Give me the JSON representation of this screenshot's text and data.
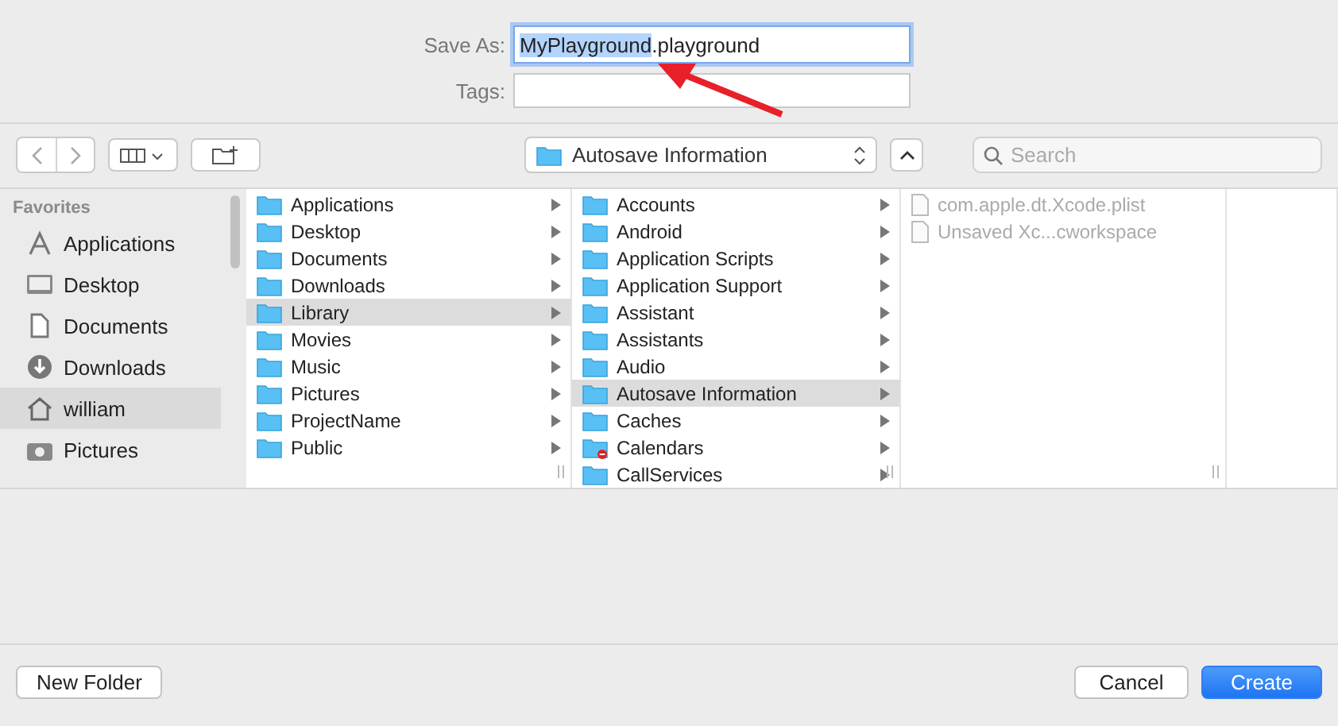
{
  "save_as": {
    "label": "Save As:",
    "selected_text": "MyPlayground",
    "text": ".playground"
  },
  "tags": {
    "label": "Tags:"
  },
  "toolbar": {
    "location": "Autosave Information",
    "search": {
      "placeholder": "Search"
    }
  },
  "sidebar": {
    "heading": "Favorites",
    "items": [
      {
        "label": "Applications",
        "selected": false
      },
      {
        "label": "Desktop",
        "selected": false
      },
      {
        "label": "Documents",
        "selected": false
      },
      {
        "label": "Downloads",
        "selected": false
      },
      {
        "label": "william",
        "selected": true
      },
      {
        "label": "Pictures",
        "selected": false
      }
    ]
  },
  "columns": [
    {
      "items": [
        {
          "label": "Applications",
          "selected": false,
          "kind": "folder",
          "locked": false
        },
        {
          "label": "Desktop",
          "selected": false,
          "kind": "folder",
          "locked": false
        },
        {
          "label": "Documents",
          "selected": false,
          "kind": "folder",
          "locked": false
        },
        {
          "label": "Downloads",
          "selected": false,
          "kind": "folder",
          "locked": false
        },
        {
          "label": "Library",
          "selected": true,
          "kind": "folder",
          "locked": false
        },
        {
          "label": "Movies",
          "selected": false,
          "kind": "folder",
          "locked": false
        },
        {
          "label": "Music",
          "selected": false,
          "kind": "folder",
          "locked": false
        },
        {
          "label": "Pictures",
          "selected": false,
          "kind": "folder",
          "locked": false
        },
        {
          "label": "ProjectName",
          "selected": false,
          "kind": "folder",
          "locked": false
        },
        {
          "label": "Public",
          "selected": false,
          "kind": "folder",
          "locked": false
        }
      ]
    },
    {
      "items": [
        {
          "label": "Accounts",
          "selected": false,
          "kind": "folder",
          "locked": false
        },
        {
          "label": "Android",
          "selected": false,
          "kind": "folder",
          "locked": false
        },
        {
          "label": "Application Scripts",
          "selected": false,
          "kind": "folder",
          "locked": false
        },
        {
          "label": "Application Support",
          "selected": false,
          "kind": "folder",
          "locked": false
        },
        {
          "label": "Assistant",
          "selected": false,
          "kind": "folder",
          "locked": false
        },
        {
          "label": "Assistants",
          "selected": false,
          "kind": "folder",
          "locked": false
        },
        {
          "label": "Audio",
          "selected": false,
          "kind": "folder",
          "locked": false
        },
        {
          "label": "Autosave Information",
          "selected": true,
          "kind": "folder",
          "locked": false
        },
        {
          "label": "Caches",
          "selected": false,
          "kind": "folder",
          "locked": false
        },
        {
          "label": "Calendars",
          "selected": false,
          "kind": "folder",
          "locked": true
        },
        {
          "label": "CallServices",
          "selected": false,
          "kind": "folder",
          "locked": false
        }
      ]
    },
    {
      "items": [
        {
          "label": "com.apple.dt.Xcode.plist",
          "selected": false,
          "kind": "file"
        },
        {
          "label": "Unsaved Xc...cworkspace",
          "selected": false,
          "kind": "file"
        }
      ]
    }
  ],
  "buttons": {
    "new_folder": "New Folder",
    "cancel": "Cancel",
    "create": "Create"
  }
}
